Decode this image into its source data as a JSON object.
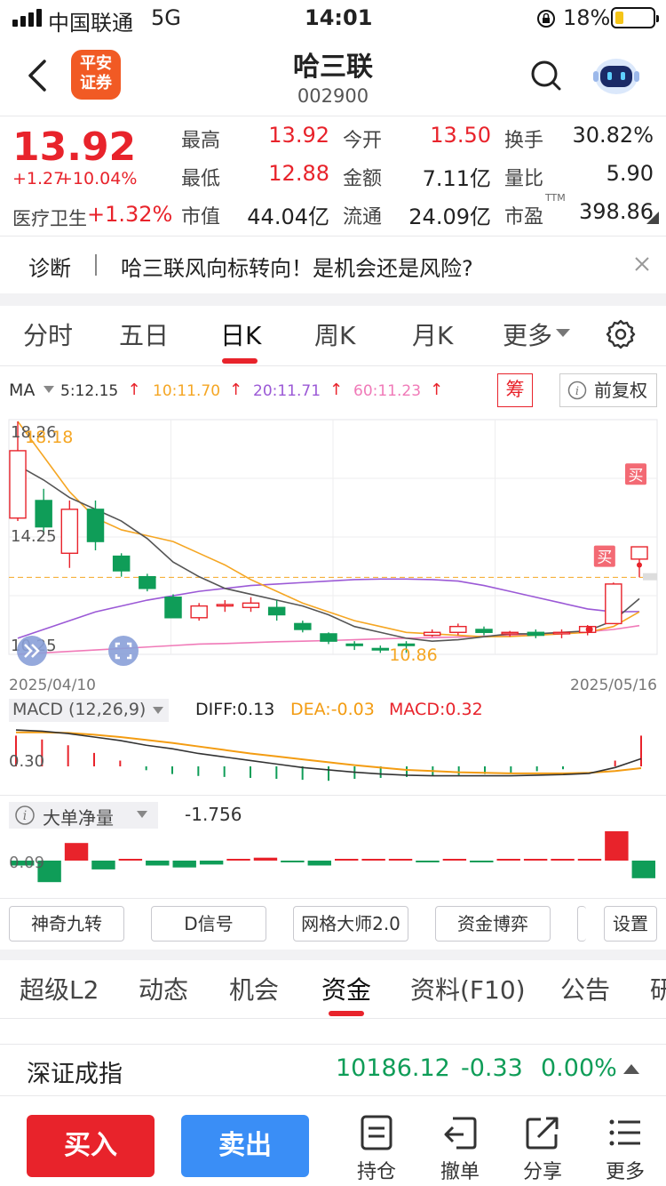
{
  "status_bar": {
    "carrier": "中国联通",
    "network": "5G",
    "time": "14:01",
    "battery": "18%",
    "battery_level": 0.18
  },
  "header": {
    "logo_text": [
      "平安",
      "证券"
    ],
    "stock_name": "哈三联",
    "stock_code": "002900"
  },
  "quote": {
    "price": "13.92",
    "change": "+1.27",
    "change_pct": "+10.04%",
    "sector_name": "医疗卫生",
    "sector_change": "+1.32%",
    "fields": [
      {
        "label": "最高",
        "value": "13.92"
      },
      {
        "label": "今开",
        "value": "13.50"
      },
      {
        "label": "换手",
        "value": "30.82%"
      },
      {
        "label": "最低",
        "value": "12.88"
      },
      {
        "label": "金额",
        "value": "7.11亿"
      },
      {
        "label": "量比",
        "value": "5.90"
      },
      {
        "label": "市值",
        "value": "44.04亿"
      },
      {
        "label": "流通",
        "value": "24.09亿"
      },
      {
        "label": "市盈",
        "value": "398.86"
      }
    ],
    "pe_superscript": "TTM"
  },
  "diagnosis": {
    "label": "诊断",
    "text": "哈三联风向标转向！是机会还是风险?"
  },
  "chart_tabs": [
    "分时",
    "五日",
    "日K",
    "周K",
    "月K",
    "更多"
  ],
  "chart_tab_active": 2,
  "ma_bar": {
    "title": "MA",
    "items": [
      {
        "label": "5:12.15",
        "color": "#333333"
      },
      {
        "label": "10:11.70",
        "color": "#f5a623"
      },
      {
        "label": "20:11.71",
        "color": "#9b59d6"
      },
      {
        "label": "60:11.23",
        "color": "#f07ab8"
      }
    ],
    "chip_label": "筹",
    "adjust_label": "前复权"
  },
  "chart_data": {
    "type": "candlestick",
    "y_labels": [
      "18.26",
      "14.25",
      "10.25"
    ],
    "max_label": "18.18",
    "min_label": "10.86",
    "x_start": "2025/04/10",
    "x_end": "2025/05/16",
    "buy_marker": "买",
    "candles": [
      {
        "o": 14.9,
        "c": 17.2,
        "h": 18.2,
        "l": 14.8
      },
      {
        "o": 15.5,
        "c": 14.6,
        "h": 15.9,
        "l": 14.4
      },
      {
        "o": 13.7,
        "c": 15.2,
        "h": 15.5,
        "l": 13.2
      },
      {
        "o": 15.2,
        "c": 14.1,
        "h": 15.5,
        "l": 13.8
      },
      {
        "o": 13.6,
        "c": 13.1,
        "h": 13.7,
        "l": 12.9
      },
      {
        "o": 12.9,
        "c": 12.5,
        "h": 13.0,
        "l": 12.4
      },
      {
        "o": 12.2,
        "c": 11.5,
        "h": 12.3,
        "l": 11.5
      },
      {
        "o": 11.5,
        "c": 11.9,
        "h": 12.0,
        "l": 11.4
      },
      {
        "o": 11.9,
        "c": 11.95,
        "h": 12.1,
        "l": 11.7
      },
      {
        "o": 11.85,
        "c": 12.0,
        "h": 12.2,
        "l": 11.7
      },
      {
        "o": 11.85,
        "c": 11.6,
        "h": 12.1,
        "l": 11.4
      },
      {
        "o": 11.3,
        "c": 11.1,
        "h": 11.4,
        "l": 11.0
      },
      {
        "o": 10.95,
        "c": 10.7,
        "h": 11.0,
        "l": 10.6
      },
      {
        "o": 10.6,
        "c": 10.55,
        "h": 10.7,
        "l": 10.4
      },
      {
        "o": 10.45,
        "c": 10.4,
        "h": 10.55,
        "l": 10.3
      },
      {
        "o": 10.6,
        "c": 10.55,
        "h": 10.7,
        "l": 10.3
      },
      {
        "o": 10.9,
        "c": 11.0,
        "h": 11.1,
        "l": 10.85
      },
      {
        "o": 11.0,
        "c": 11.2,
        "h": 11.3,
        "l": 10.9
      },
      {
        "o": 11.1,
        "c": 11.0,
        "h": 11.2,
        "l": 10.9
      },
      {
        "o": 10.95,
        "c": 11.0,
        "h": 11.05,
        "l": 10.85
      },
      {
        "o": 11.0,
        "c": 10.9,
        "h": 11.1,
        "l": 10.8
      },
      {
        "o": 10.95,
        "c": 11.0,
        "h": 11.1,
        "l": 10.8
      },
      {
        "o": 11.0,
        "c": 11.2,
        "h": 11.25,
        "l": 10.9
      },
      {
        "o": 11.3,
        "c": 12.65,
        "h": 12.7,
        "l": 11.3
      },
      {
        "o": 13.5,
        "c": 13.92,
        "h": 13.92,
        "l": 12.88
      }
    ],
    "ma5": [
      16.7,
      16.2,
      15.6,
      15.2,
      14.8,
      14.2,
      13.4,
      12.9,
      12.5,
      12.3,
      12.1,
      11.9,
      11.6,
      11.2,
      11.0,
      10.8,
      10.7,
      10.75,
      10.85,
      10.95,
      10.95,
      11.0,
      11.05,
      11.4,
      12.15
    ],
    "ma10": [
      18.2,
      17.0,
      15.8,
      14.9,
      14.5,
      14.3,
      14.1,
      13.7,
      13.3,
      12.8,
      12.4,
      12.0,
      11.7,
      11.4,
      11.2,
      11.0,
      10.95,
      10.9,
      10.85,
      10.86,
      10.9,
      10.95,
      11.0,
      11.2,
      11.7
    ],
    "ma20": [
      10.8,
      11.1,
      11.4,
      11.7,
      11.9,
      12.1,
      12.25,
      12.4,
      12.5,
      12.6,
      12.65,
      12.7,
      12.75,
      12.8,
      12.82,
      12.82,
      12.8,
      12.75,
      12.6,
      12.4,
      12.2,
      12.0,
      11.8,
      11.7,
      11.71
    ],
    "ma60": [
      10.25,
      10.3,
      10.35,
      10.4,
      10.45,
      10.5,
      10.55,
      10.6,
      10.62,
      10.65,
      10.68,
      10.7,
      10.72,
      10.75,
      10.78,
      10.8,
      10.82,
      10.84,
      10.87,
      10.9,
      10.93,
      10.97,
      11.02,
      11.1,
      11.23
    ],
    "y_range": [
      10.25,
      18.26
    ]
  },
  "macd": {
    "title": "MACD (12,26,9)",
    "diff": "DIFF:0.13",
    "dea": "DEA:-0.03",
    "macd": "MACD:0.32",
    "scale_label": "0.30",
    "bars": [
      0.32,
      0.28,
      0.22,
      0.14,
      0.06,
      -0.04,
      -0.08,
      -0.1,
      -0.11,
      -0.12,
      -0.13,
      -0.14,
      -0.15,
      -0.13,
      -0.12,
      -0.11,
      -0.1,
      -0.09,
      -0.08,
      -0.07,
      -0.05,
      -0.03,
      0.0,
      0.06,
      0.32
    ],
    "diff_line": [
      0.62,
      0.6,
      0.56,
      0.5,
      0.44,
      0.36,
      0.3,
      0.22,
      0.16,
      0.1,
      0.04,
      -0.02,
      -0.06,
      -0.1,
      -0.13,
      -0.15,
      -0.16,
      -0.16,
      -0.16,
      -0.16,
      -0.15,
      -0.14,
      -0.12,
      -0.02,
      0.13
    ],
    "dea_line": [
      0.58,
      0.58,
      0.57,
      0.54,
      0.5,
      0.45,
      0.4,
      0.34,
      0.28,
      0.22,
      0.17,
      0.12,
      0.07,
      0.02,
      -0.02,
      -0.06,
      -0.08,
      -0.1,
      -0.11,
      -0.12,
      -0.12,
      -0.12,
      -0.11,
      -0.08,
      -0.03
    ]
  },
  "big_order": {
    "title": "大单净量",
    "value": "-1.756",
    "scale_label": "0.09",
    "bars": [
      -0.5,
      -2.2,
      1.8,
      -0.9,
      0.1,
      -0.5,
      -0.7,
      -0.4,
      0.1,
      0.3,
      -0.1,
      -0.5,
      0.1,
      0.1,
      0.1,
      -0.1,
      0.1,
      -0.1,
      0.1,
      0.1,
      0.1,
      0.1,
      3.0,
      -1.8
    ]
  },
  "tool_buttons": [
    "神奇九转",
    "D信号",
    "网格大师2.0",
    "资金博弈",
    "设置"
  ],
  "bottom_tabs": [
    "超级L2",
    "动态",
    "机会",
    "资金",
    "资料(F10)",
    "公告",
    "研"
  ],
  "bottom_tab_active": 3,
  "index_bar": {
    "name": "深证成指",
    "value": "10186.12",
    "change": "-0.33",
    "change_pct": "0.00%"
  },
  "actions": {
    "buy": "买入",
    "sell": "卖出",
    "icons": [
      "持仓",
      "撤单",
      "分享",
      "更多"
    ]
  }
}
